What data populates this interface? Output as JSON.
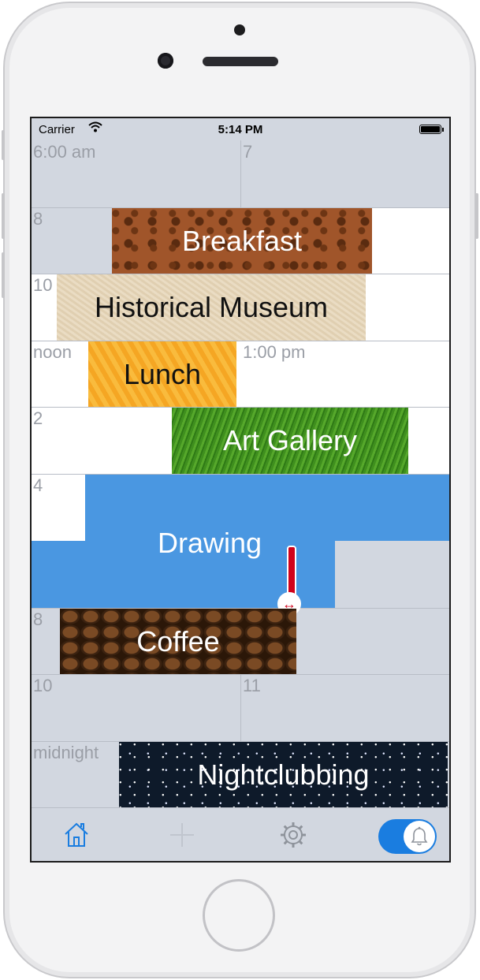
{
  "status_bar": {
    "carrier": "Carrier",
    "time": "5:14 PM"
  },
  "hour_labels": {
    "h6am": "6:00 am",
    "h7": "7",
    "h8": "8",
    "h10": "10",
    "noon": "noon",
    "h1pm": "1:00 pm",
    "h2": "2",
    "h4": "4",
    "h8pm": "8",
    "h10pm": "10",
    "h11": "11",
    "midnight": "midnight"
  },
  "events": {
    "breakfast": "Breakfast",
    "museum": "Historical Museum",
    "lunch": "Lunch",
    "art": "Art Gallery",
    "drawing": "Drawing",
    "coffee": "Coffee",
    "night": "Nightclubbing"
  },
  "tab_bar": {
    "home_icon": "home-icon",
    "add_icon": "plus-icon",
    "settings_icon": "gear-icon",
    "alarm_icon": "bell-icon",
    "alarm_toggle_on": true
  },
  "colors": {
    "accent": "#1a7de0",
    "drawing_event": "#4a97e1",
    "grid_gray": "#d2d7e0",
    "resize_handle": "#d0021b"
  }
}
